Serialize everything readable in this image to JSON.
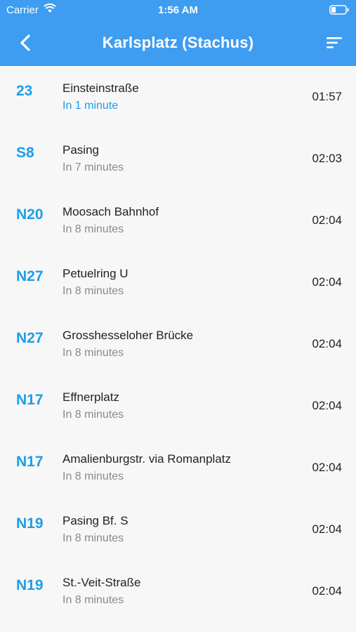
{
  "status_bar": {
    "carrier": "Carrier",
    "time": "1:56 AM"
  },
  "header": {
    "title": "Karlsplatz (Stachus)"
  },
  "departures": [
    {
      "line": "23",
      "destination": "Einsteinstraße",
      "eta": "In 1 minute",
      "time": "01:57",
      "soon": true
    },
    {
      "line": "S8",
      "destination": "Pasing",
      "eta": "In 7 minutes",
      "time": "02:03",
      "soon": false
    },
    {
      "line": "N20",
      "destination": "Moosach Bahnhof",
      "eta": "In 8 minutes",
      "time": "02:04",
      "soon": false
    },
    {
      "line": "N27",
      "destination": "Petuelring U",
      "eta": "In 8 minutes",
      "time": "02:04",
      "soon": false
    },
    {
      "line": "N27",
      "destination": "Grosshesseloher Brücke",
      "eta": "In 8 minutes",
      "time": "02:04",
      "soon": false
    },
    {
      "line": "N17",
      "destination": "Effnerplatz",
      "eta": "In 8 minutes",
      "time": "02:04",
      "soon": false
    },
    {
      "line": "N17",
      "destination": "Amalienburgstr. via Romanplatz",
      "eta": "In 8 minutes",
      "time": "02:04",
      "soon": false
    },
    {
      "line": "N19",
      "destination": "Pasing Bf. S",
      "eta": "In 8 minutes",
      "time": "02:04",
      "soon": false
    },
    {
      "line": "N19",
      "destination": "St.-Veit-Straße",
      "eta": "In 8 minutes",
      "time": "02:04",
      "soon": false
    }
  ],
  "colors": {
    "header": "#3e9df0",
    "accent": "#1c9ee8",
    "background": "#f7f7f7"
  },
  "icons": {
    "back": "chevron-left-icon",
    "sort": "sort-lines-icon",
    "wifi": "wifi-icon",
    "battery": "battery-icon"
  }
}
